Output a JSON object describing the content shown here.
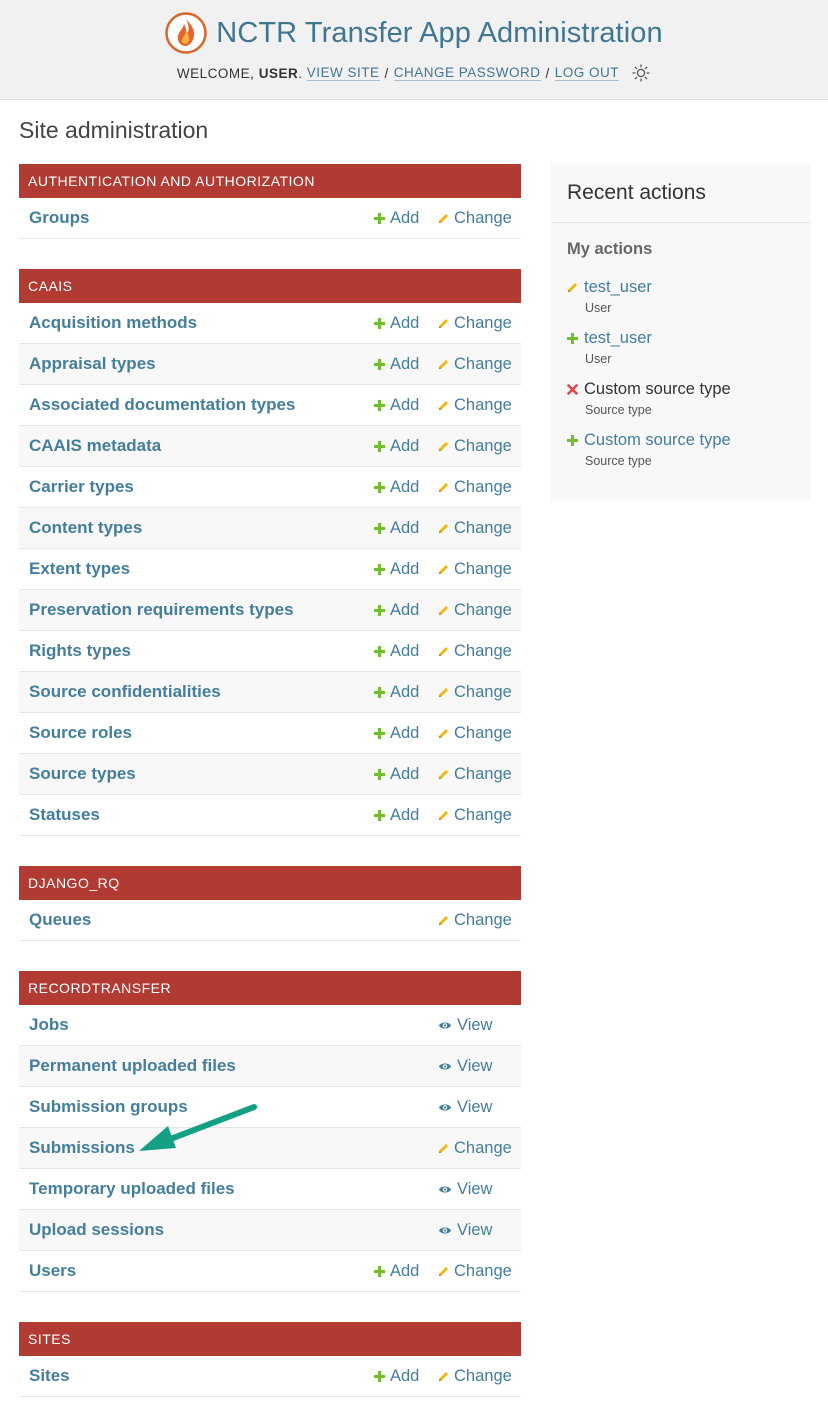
{
  "header": {
    "site_name": "NCTR Transfer App Administration",
    "welcome": "Welcome,",
    "username": "user",
    "view_site": "View site",
    "change_password": "Change password",
    "log_out": "Log out",
    "theme_icon": "sun-icon"
  },
  "page": {
    "title": "Site administration"
  },
  "modules": [
    {
      "caption": "Authentication and Authorization",
      "rows": [
        {
          "name": "Groups",
          "add": "Add",
          "change": "Change"
        }
      ]
    },
    {
      "caption": "CAAIS",
      "rows": [
        {
          "name": "Acquisition methods",
          "add": "Add",
          "change": "Change"
        },
        {
          "name": "Appraisal types",
          "add": "Add",
          "change": "Change"
        },
        {
          "name": "Associated documentation types",
          "add": "Add",
          "change": "Change"
        },
        {
          "name": "CAAIS metadata",
          "add": "Add",
          "change": "Change"
        },
        {
          "name": "Carrier types",
          "add": "Add",
          "change": "Change"
        },
        {
          "name": "Content types",
          "add": "Add",
          "change": "Change"
        },
        {
          "name": "Extent types",
          "add": "Add",
          "change": "Change"
        },
        {
          "name": "Preservation requirements types",
          "add": "Add",
          "change": "Change"
        },
        {
          "name": "Rights types",
          "add": "Add",
          "change": "Change"
        },
        {
          "name": "Source confidentialities",
          "add": "Add",
          "change": "Change"
        },
        {
          "name": "Source roles",
          "add": "Add",
          "change": "Change"
        },
        {
          "name": "Source types",
          "add": "Add",
          "change": "Change"
        },
        {
          "name": "Statuses",
          "add": "Add",
          "change": "Change"
        }
      ]
    },
    {
      "caption": "DJANGO_RQ",
      "rows": [
        {
          "name": "Queues",
          "change": "Change"
        }
      ]
    },
    {
      "caption": "RECORDTRANSFER",
      "rows": [
        {
          "name": "Jobs",
          "view": "View"
        },
        {
          "name": "Permanent uploaded files",
          "view": "View"
        },
        {
          "name": "Submission groups",
          "view": "View"
        },
        {
          "name": "Submissions",
          "change": "Change"
        },
        {
          "name": "Temporary uploaded files",
          "view": "View"
        },
        {
          "name": "Upload sessions",
          "view": "View"
        },
        {
          "name": "Users",
          "add": "Add",
          "change": "Change"
        }
      ]
    },
    {
      "caption": "Sites",
      "rows": [
        {
          "name": "Sites",
          "add": "Add",
          "change": "Change"
        }
      ]
    }
  ],
  "recent_actions": {
    "title": "Recent actions",
    "subtitle": "My actions",
    "items": [
      {
        "action": "change",
        "label": "test_user",
        "type": "User"
      },
      {
        "action": "add",
        "label": "test_user",
        "type": "User"
      },
      {
        "action": "delete",
        "label": "Custom source type",
        "type": "Source type"
      },
      {
        "action": "add",
        "label": "Custom source type",
        "type": "Source type"
      }
    ]
  },
  "colors": {
    "module_header": "#b13a33",
    "link": "#447e9b",
    "add_icon": "#70bf2b",
    "change_icon": "#efb80b",
    "delete_icon": "#dd4646",
    "annotation_arrow": "#14a085"
  }
}
